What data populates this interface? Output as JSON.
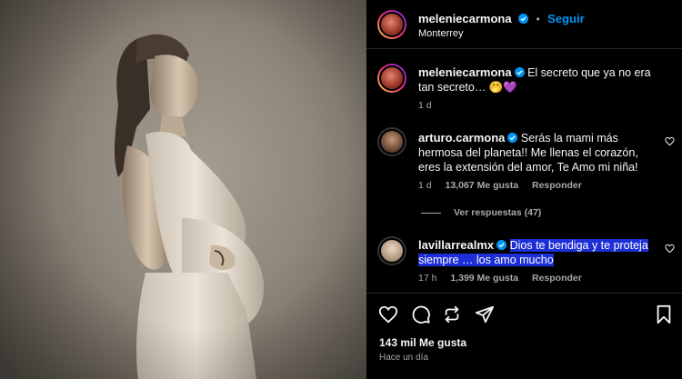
{
  "post": {
    "author": "meleniecarmona",
    "follow_label": "Seguir",
    "separator": "•",
    "location": "Monterrey"
  },
  "caption": {
    "username": "meleniecarmona",
    "text": "El secreto que ya no era tan secreto… 🤭💜",
    "time": "1 d"
  },
  "comments": [
    {
      "username": "arturo.carmona",
      "text": "Serás la mami más hermosa del planeta!! Me llenas el corazón, eres la extensión del amor, Te Amo mi niña!",
      "time": "1 d",
      "likes": "13,067 Me gusta",
      "reply_label": "Responder",
      "view_replies": "Ver respuestas (47)"
    },
    {
      "username": "lavillarrealmx",
      "text": "Dios te bendiga y te proteja siempre … los amo mucho",
      "time": "17 h",
      "likes": "1,399 Me gusta",
      "reply_label": "Responder"
    }
  ],
  "footer": {
    "likes": "143 mil Me gusta",
    "time_ago": "Hace un día"
  },
  "icons": [
    "verified-icon",
    "heart-icon",
    "comment-icon",
    "share-icon",
    "send-icon",
    "bookmark-icon"
  ],
  "colors": {
    "accent": "#0095f6",
    "background": "#000000",
    "secondary_text": "#a8a8a8",
    "highlight": "#1d2fd6"
  }
}
